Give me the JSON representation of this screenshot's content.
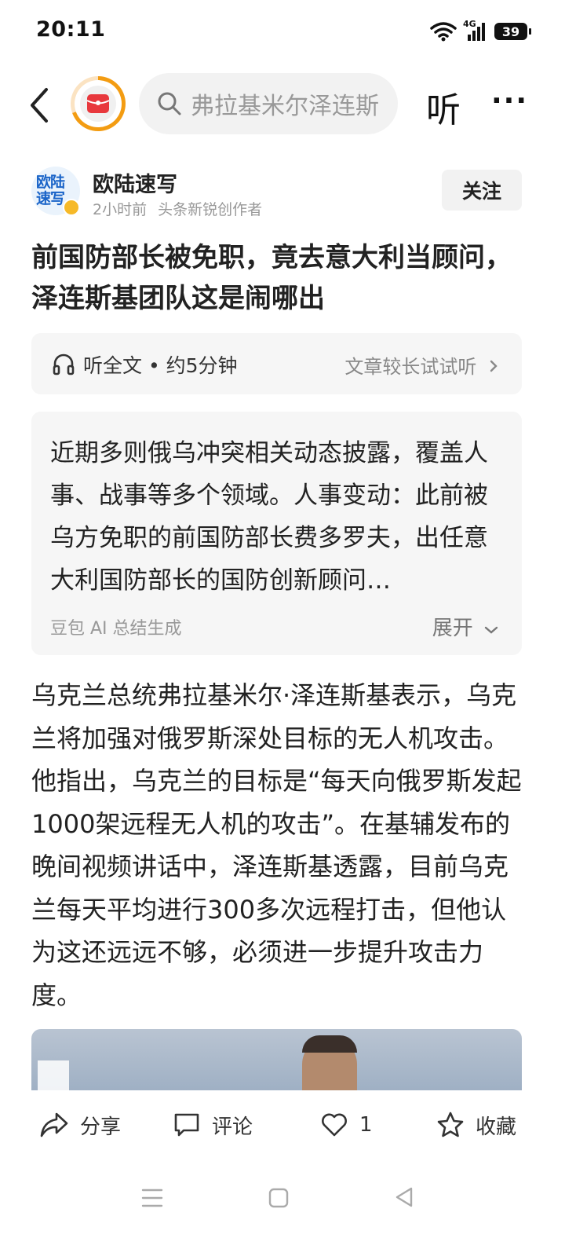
{
  "status_bar": {
    "time": "20:11",
    "network": "4G",
    "battery": "39"
  },
  "top_bar": {
    "search_placeholder": "弗拉基米尔泽连斯",
    "listen_label": "听",
    "more_label": "···"
  },
  "author": {
    "avatar_text_line1": "欧陆",
    "avatar_text_line2": "速写",
    "name": "欧陆速写",
    "time": "2小时前",
    "tag": "头条新锐创作者",
    "follow_label": "关注"
  },
  "article": {
    "title": "前国防部长被免职，竟去意大利当顾问，泽连斯基团队这是闹哪出",
    "listen_label": "听全文 • 约5分钟",
    "listen_hint": "文章较长试试听",
    "summary": "近期多则俄乌冲突相关动态披露，覆盖人事、战事等多个领域。人事变动：此前被乌方免职的前国防部长费多罗夫，出任意大利国防部长的国防创新顾问…",
    "summary_source": "豆包 AI 总结生成",
    "summary_expand": "展开",
    "body": "乌克兰总统弗拉基米尔·泽连斯基表示，乌克兰将加强对俄罗斯深处目标的无人机攻击。他指出，乌克兰的目标是“每天向俄罗斯发起1000架远程无人机的攻击”。在基辅发布的晚间视频讲话中，泽连斯基透露，目前乌克兰每天平均进行300多次远程打击，但他认为这还远远不够，必须进一步提升攻击力度。"
  },
  "actions": {
    "share_label": "分享",
    "comment_label": "评论",
    "like_count": "1",
    "favorite_label": "收藏"
  },
  "colors": {
    "accent_orange": "#f39c12",
    "logo_red": "#e8383d",
    "avatar_blue": "#1a64c8"
  }
}
